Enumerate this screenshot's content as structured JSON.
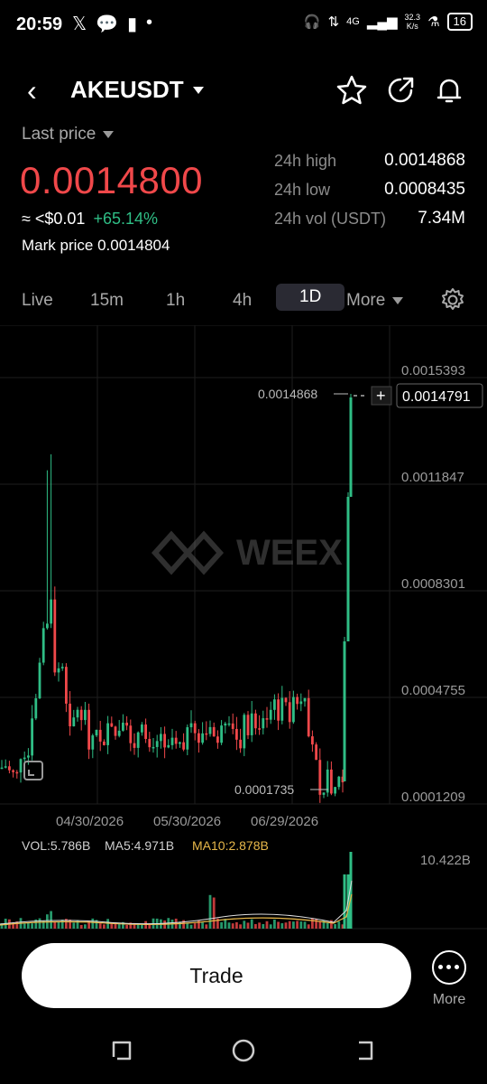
{
  "status": {
    "time": "20:59",
    "net_speed_top": "32.3",
    "net_speed_bottom": "K/s",
    "network": "4G",
    "battery": "16"
  },
  "header": {
    "pair": "AKEUSDT"
  },
  "price": {
    "last_price_label": "Last price",
    "value": "0.0014800",
    "approx": "≈ <$0.01",
    "change": "+65.14%",
    "mark_label": "Mark price",
    "mark_value": "0.0014804"
  },
  "stats": [
    {
      "label": "24h high",
      "value": "0.0014868"
    },
    {
      "label": "24h low",
      "value": "0.0008435"
    },
    {
      "label": "24h vol (USDT)",
      "value": "7.34M"
    }
  ],
  "tabs": [
    {
      "label": "Live",
      "active": false
    },
    {
      "label": "15m",
      "active": false
    },
    {
      "label": "1h",
      "active": false
    },
    {
      "label": "4h",
      "active": false
    },
    {
      "label": "1D",
      "active": true
    },
    {
      "label": "More",
      "active": false
    }
  ],
  "chart": {
    "watermark": "WEEX",
    "y_ticks": [
      "0.0015393",
      "0.0011847",
      "0.0008301",
      "0.0004755",
      "0.0001209"
    ],
    "x_ticks": [
      "04/30/2026",
      "05/30/2026",
      "06/29/2026"
    ],
    "high_marker": "0.0014868",
    "low_marker": "0.0001735",
    "current_price_tag": "0.0014791",
    "colors": {
      "up": "#2fbd85",
      "down": "#f0484a",
      "ma5": "#e0e0e0",
      "ma10": "#e8b84a"
    }
  },
  "volume": {
    "vol_label": "VOL:5.786B",
    "ma5_label": "MA5:4.971B",
    "ma10_label": "MA10:2.878B",
    "max_label": "10.422B"
  },
  "actions": {
    "trade_label": "Trade",
    "more_label": "More"
  }
}
